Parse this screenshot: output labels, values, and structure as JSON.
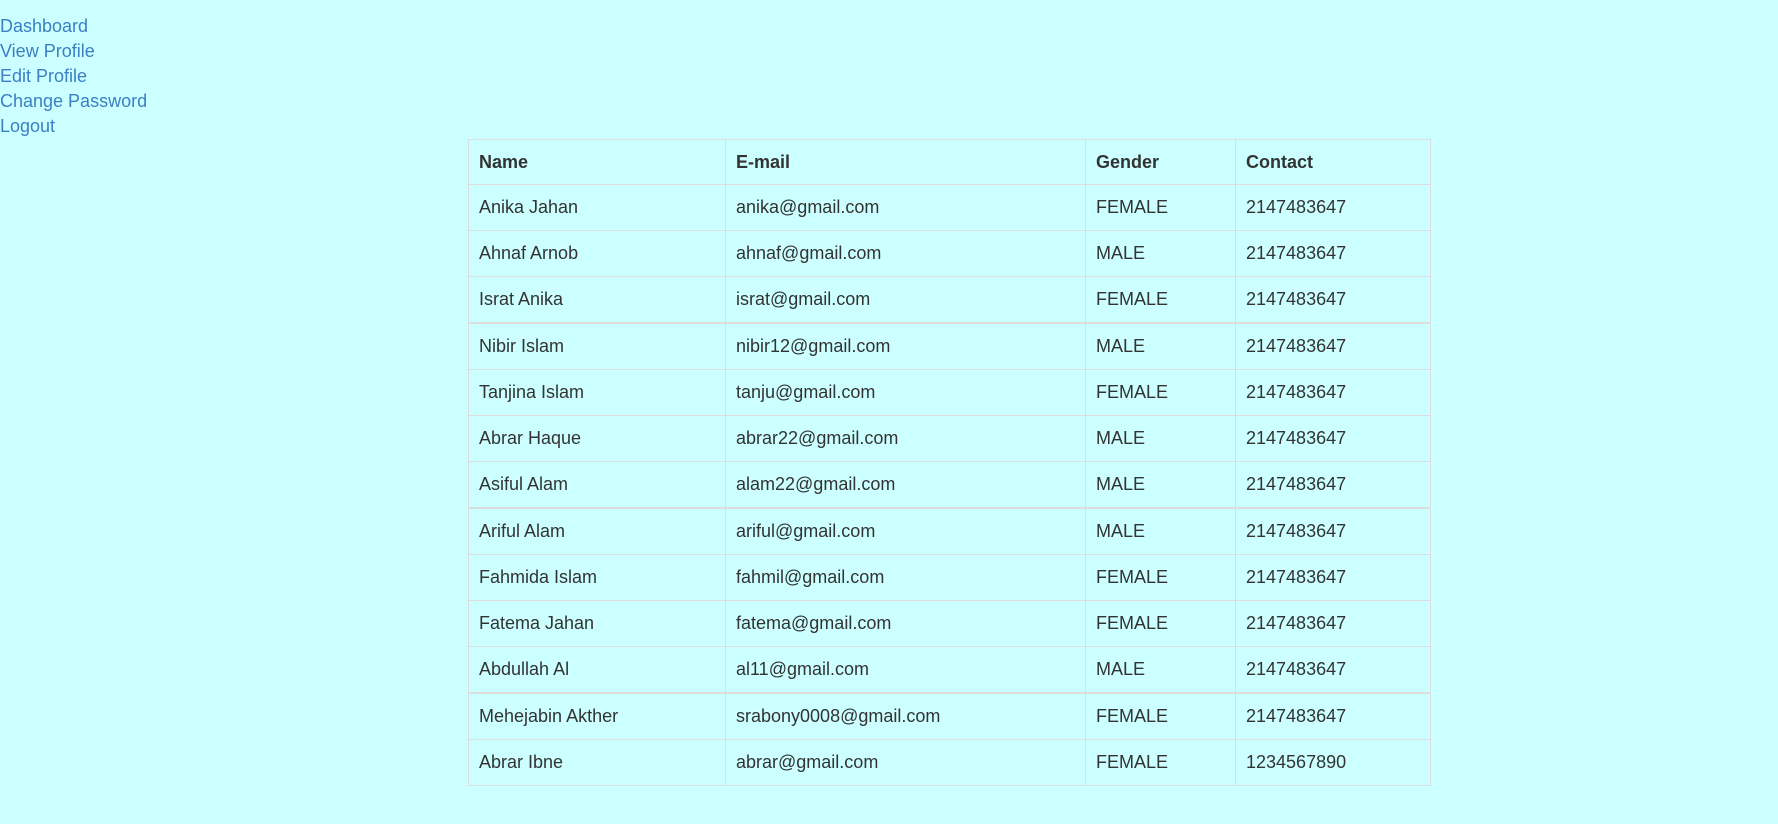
{
  "nav": {
    "items": [
      {
        "label": "Dashboard"
      },
      {
        "label": "View Profile"
      },
      {
        "label": "Edit Profile"
      },
      {
        "label": "Change Password"
      },
      {
        "label": "Logout"
      }
    ]
  },
  "colors": {
    "background": "#ccffff",
    "link": "#3b7fc4",
    "text": "#333333",
    "border": "#dddddd"
  },
  "table": {
    "headers": [
      "Name",
      "E-mail",
      "Gender",
      "Contact"
    ],
    "rows": [
      [
        "Anika Jahan",
        "anika@gmail.com",
        "FEMALE",
        "2147483647"
      ],
      [
        "Ahnaf Arnob",
        "ahnaf@gmail.com",
        "MALE",
        "2147483647"
      ],
      [
        "Israt Anika",
        "israt@gmail.com",
        "FEMALE",
        "2147483647"
      ],
      [
        "Nibir Islam",
        "nibir12@gmail.com",
        "MALE",
        "2147483647"
      ],
      [
        "Tanjina Islam",
        "tanju@gmail.com",
        "FEMALE",
        "2147483647"
      ],
      [
        "Abrar Haque",
        "abrar22@gmail.com",
        "MALE",
        "2147483647"
      ],
      [
        "Asiful Alam",
        "alam22@gmail.com",
        "MALE",
        "2147483647"
      ],
      [
        "Ariful Alam",
        "ariful@gmail.com",
        "MALE",
        "2147483647"
      ],
      [
        "Fahmida Islam",
        "fahmil@gmail.com",
        "FEMALE",
        "2147483647"
      ],
      [
        "Fatema Jahan",
        "fatema@gmail.com",
        "FEMALE",
        "2147483647"
      ],
      [
        "Abdullah Al",
        "al11@gmail.com",
        "MALE",
        "2147483647"
      ],
      [
        "Mehejabin Akther",
        "srabony0008@gmail.com",
        "FEMALE",
        "2147483647"
      ],
      [
        "Abrar Ibne",
        "abrar@gmail.com",
        "FEMALE",
        "1234567890"
      ]
    ]
  }
}
